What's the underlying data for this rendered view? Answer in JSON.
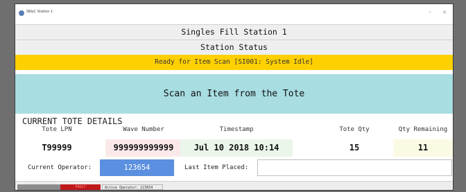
{
  "window": {
    "title": "SB&C Station 1",
    "minimize_glyph": "–",
    "close_glyph": "×"
  },
  "header": {
    "station_name": "Singles Fill Station 1",
    "status_heading": "Station Status"
  },
  "status": {
    "message": "Ready for Item Scan [SI001: System Idle]",
    "color": "#ffd000"
  },
  "scan_prompt": {
    "text": "Scan an Item from the Tote",
    "color": "#a8dde2"
  },
  "tote_details": {
    "title": "CURRENT TOTE DETAILS",
    "columns": [
      {
        "label": "Tote LPN",
        "value": "T99999",
        "bg": "#ffffff"
      },
      {
        "label": "Wave Number",
        "value": "999999999999",
        "bg": "#fbe9ea"
      },
      {
        "label": "Timestamp",
        "value": "Jul 10 2018 10:14",
        "bg": "#eaf6ea"
      },
      {
        "label": "Tote Qty",
        "value": "15",
        "bg": "#ffffff"
      },
      {
        "label": "Qty Remaining",
        "value": "11",
        "bg": "#fbfbe4"
      }
    ]
  },
  "operator": {
    "label": "Current Operator:",
    "value": "123654",
    "color": "#5b8fdf"
  },
  "last_item": {
    "label": "Last Item Placed:",
    "value": ""
  },
  "statusbar": {
    "indicator_text": "FAULT",
    "active_operator": "Active Operator: 123654"
  }
}
